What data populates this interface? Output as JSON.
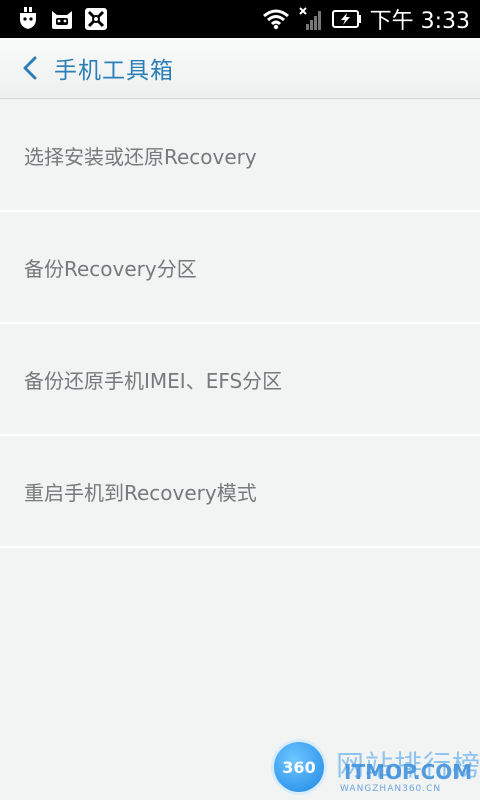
{
  "status_bar": {
    "time": "下午 3:33",
    "left_icons": [
      "usb-debug-icon",
      "cat-app-icon",
      "tools-app-icon"
    ],
    "right_icons": [
      "wifi-icon",
      "no-signal-icon",
      "battery-charging-icon"
    ]
  },
  "header": {
    "title": "手机工具箱",
    "back_icon": "chevron-left-icon",
    "accent_color": "#2a7fb8"
  },
  "menu": {
    "items": [
      {
        "label": "选择安装或还原Recovery"
      },
      {
        "label": "备份Recovery分区"
      },
      {
        "label": "备份还原手机IMEI、EFS分区"
      },
      {
        "label": "重启手机到Recovery模式"
      }
    ]
  },
  "watermark": {
    "badge": "360",
    "text": "网站排行榜",
    "brand": "ITMOP.COM",
    "sub": "WANGZHAN360.CN"
  }
}
